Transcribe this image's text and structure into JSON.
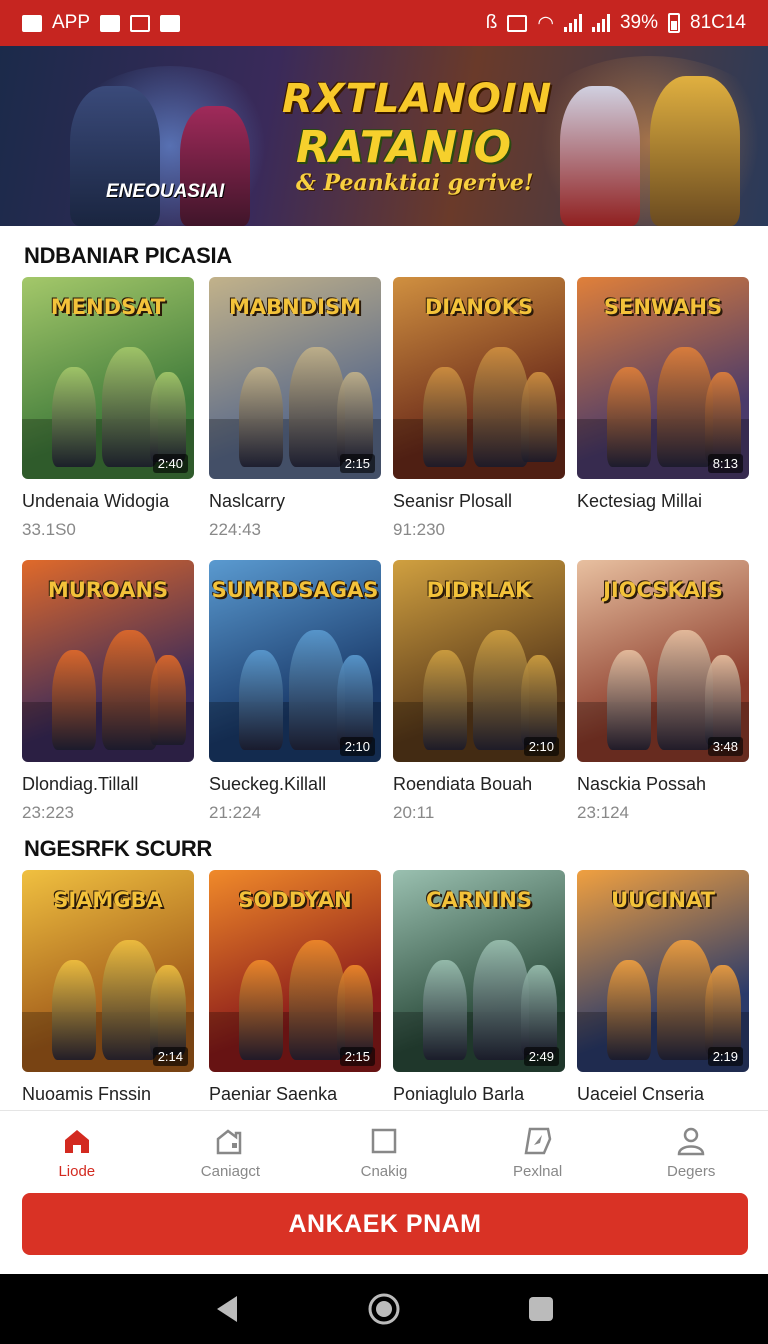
{
  "status_bar": {
    "app_label": "APP",
    "battery": "39%",
    "time": "81C14"
  },
  "banner": {
    "title_line1": "RXTLANOIN",
    "title_line2": "RATANIO",
    "subtitle": "& Peanktiai gerive!",
    "label": "ENEOUASIAI"
  },
  "sections": [
    {
      "title": "NDBANIAR PICASIA",
      "items": [
        {
          "art_title": "MENDSAT",
          "name": "Undenaia Widogia",
          "meta": "33.1S0",
          "duration": "2:40",
          "palette": [
            "#3f7a3a",
            "#a4c86a"
          ]
        },
        {
          "art_title": "MABNDISM",
          "name": "Naslcarry",
          "meta": "224:43",
          "duration": "2:15",
          "palette": [
            "#5a6a8a",
            "#c2b28a"
          ]
        },
        {
          "art_title": "DIANOKS",
          "name": "Seanisr Plosall",
          "meta": "91:230",
          "duration": "",
          "palette": [
            "#6a2a1a",
            "#d09040"
          ]
        },
        {
          "art_title": "SENWAHS",
          "name": "Kectesiag Millai",
          "meta": "",
          "duration": "8:13",
          "palette": [
            "#4a3a6a",
            "#e0803a"
          ]
        }
      ]
    },
    {
      "title": "",
      "items": [
        {
          "art_title": "MUROANS",
          "name": "Dlondiag.Tillall",
          "meta": "23:223",
          "duration": "",
          "palette": [
            "#3a2a5a",
            "#e06a2a"
          ]
        },
        {
          "art_title": "SUMRDSAGAS",
          "name": "Sueckeg.Killall",
          "meta": "21:224",
          "duration": "2:10",
          "palette": [
            "#1a3a6a",
            "#5a9ad0"
          ]
        },
        {
          "art_title": "DIDRLAK",
          "name": "Roendiata Bouah",
          "meta": "20:11",
          "duration": "2:10",
          "palette": [
            "#5a3a1a",
            "#d0a040"
          ]
        },
        {
          "art_title": "JIOCSKAIS",
          "name": "Nasckia Possah",
          "meta": "23:124",
          "duration": "3:48",
          "palette": [
            "#8a3a2a",
            "#e8c0a0"
          ]
        }
      ]
    },
    {
      "title": "NGESRFK SCURR",
      "items": [
        {
          "art_title": "SIAMGBA",
          "name": "Nuoamis Fnssin",
          "meta": "",
          "duration": "2:14",
          "palette": [
            "#a05a1a",
            "#f0c040"
          ]
        },
        {
          "art_title": "SODDYAN",
          "name": "Paeniar Saenka",
          "meta": "",
          "duration": "2:15",
          "palette": [
            "#8a1a1a",
            "#f08a2a"
          ]
        },
        {
          "art_title": "CARNINS",
          "name": "Poniaglulo Barla",
          "meta": "",
          "duration": "2:49",
          "palette": [
            "#2a4a3a",
            "#9ac0b0"
          ]
        },
        {
          "art_title": "UUCINAT",
          "name": "Uaceiel Cnseria",
          "meta": "",
          "duration": "2:19",
          "palette": [
            "#2a3a6a",
            "#f0a040"
          ]
        }
      ]
    }
  ],
  "bottom_nav": [
    {
      "label": "Liode",
      "icon": "home-icon",
      "active": true
    },
    {
      "label": "Caniagct",
      "icon": "category-icon",
      "active": false
    },
    {
      "label": "Cnakig",
      "icon": "square-icon",
      "active": false
    },
    {
      "label": "Pexlnal",
      "icon": "compass-icon",
      "active": false
    },
    {
      "label": "Degers",
      "icon": "user-icon",
      "active": false
    }
  ],
  "cta": {
    "label": "ANKAEK PNAM"
  },
  "colors": {
    "accent": "#d93225",
    "status_bar": "#c62520",
    "nav_active": "#d32a20"
  }
}
